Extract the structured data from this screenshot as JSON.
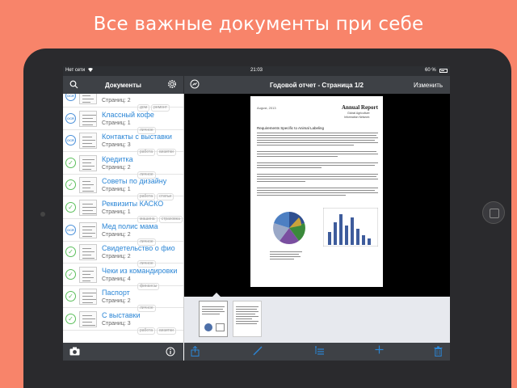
{
  "headline": "Все важные документы при себе",
  "status": {
    "carrier": "Нет сети",
    "time": "21:03",
    "battery": "60 %"
  },
  "sidebar": {
    "title": "Документы",
    "search_icon": "search-icon",
    "settings_icon": "gear-icon",
    "documents": [
      {
        "name": "",
        "pages": "Страниц: 2",
        "tags": [
          "дом",
          "ремонт"
        ],
        "status": "ocr"
      },
      {
        "name": "Классный кофе",
        "pages": "Страниц: 1",
        "tags": [
          "личное"
        ],
        "status": "ocr"
      },
      {
        "name": "Контакты с выставки",
        "pages": "Страниц: 3",
        "tags": [
          "работа",
          "визитки"
        ],
        "status": "ocr"
      },
      {
        "name": "Кредитка",
        "pages": "Страниц: 2",
        "tags": [
          "личное"
        ],
        "status": "done"
      },
      {
        "name": "Советы по дизайну",
        "pages": "Страниц: 1",
        "tags": [
          "работа",
          "статьи"
        ],
        "status": "done"
      },
      {
        "name": "Реквизиты КАСКО",
        "pages": "Страниц: 1",
        "tags": [
          "машина",
          "страховка"
        ],
        "status": "done"
      },
      {
        "name": "Мед полис мама",
        "pages": "Страниц: 2",
        "tags": [
          "личное"
        ],
        "status": "ocr"
      },
      {
        "name": "Свидетельство о фио",
        "pages": "Страниц: 2",
        "tags": [
          "личное"
        ],
        "status": "done"
      },
      {
        "name": "Чеки из командировки",
        "pages": "Страниц: 4",
        "tags": [
          "финансы"
        ],
        "status": "done"
      },
      {
        "name": "Паспорт",
        "pages": "Страниц: 2",
        "tags": [
          "личное"
        ],
        "status": "done"
      },
      {
        "name": "С выставки",
        "pages": "Страниц: 3",
        "tags": [
          "работа",
          "визитки"
        ],
        "status": "done"
      }
    ],
    "toolbar": {
      "camera_icon": "camera-icon",
      "info_icon": "info-icon"
    }
  },
  "viewer": {
    "title": "Годовой отчет - Страница 1/2",
    "edit_label": "Изменить",
    "back_icon": "back-arrows-icon",
    "page": {
      "date": "August, 2013",
      "report_title": "Annual Report",
      "org_line1": "Global Agriculture",
      "org_line2": "Information Network",
      "heading": "Requirements Specific to Animal Labeling"
    },
    "toolbar": {
      "share_icon": "share-icon",
      "pen_icon": "pen-icon",
      "reorder_icon": "reorder-icon",
      "add_icon": "plus-icon",
      "trash_icon": "trash-icon"
    }
  },
  "colors": {
    "accent": "#2b86d6",
    "bar": "#3e4146",
    "background": "#f8846a",
    "check": "#5bbf5b"
  }
}
